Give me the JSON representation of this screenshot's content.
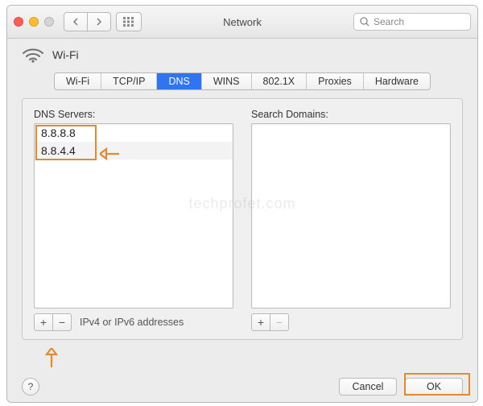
{
  "window": {
    "title": "Network",
    "search_placeholder": "Search"
  },
  "header": {
    "interface": "Wi-Fi"
  },
  "tabs": [
    {
      "label": "Wi-Fi",
      "selected": false
    },
    {
      "label": "TCP/IP",
      "selected": false
    },
    {
      "label": "DNS",
      "selected": true
    },
    {
      "label": "WINS",
      "selected": false
    },
    {
      "label": "802.1X",
      "selected": false
    },
    {
      "label": "Proxies",
      "selected": false
    },
    {
      "label": "Hardware",
      "selected": false
    }
  ],
  "dns": {
    "label": "DNS Servers:",
    "servers": [
      "8.8.8.8",
      "8.8.4.4"
    ],
    "hint": "IPv4 or IPv6 addresses"
  },
  "search_domains": {
    "label": "Search Domains:",
    "items": []
  },
  "footer": {
    "cancel": "Cancel",
    "ok": "OK",
    "help": "?"
  },
  "watermark": "techprofet.com"
}
